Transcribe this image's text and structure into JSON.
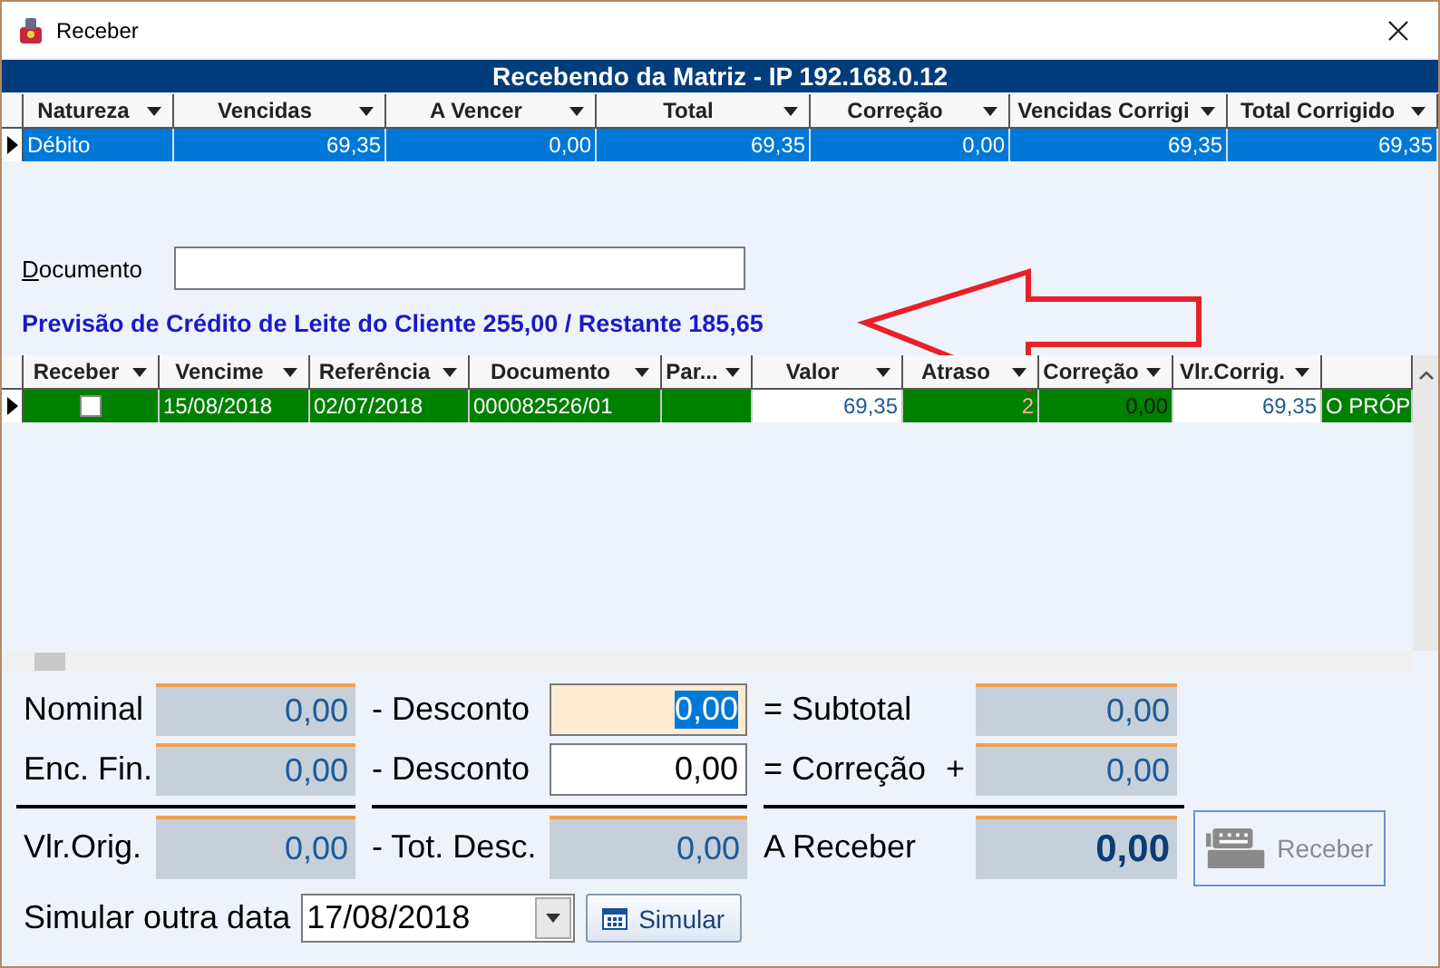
{
  "window": {
    "title": "Receber"
  },
  "header": {
    "title": "Recebendo da Matriz - IP 192.168.0.12"
  },
  "summary_table": {
    "columns": [
      "Natureza",
      "Vencidas",
      "A Vencer",
      "Total",
      "Correção",
      "Vencidas Corrigi",
      "Total Corrigido"
    ],
    "rows": [
      {
        "selected": true,
        "cells": [
          "Débito",
          "69,35",
          "0,00",
          "69,35",
          "0,00",
          "69,35",
          "69,35"
        ]
      }
    ]
  },
  "document_field": {
    "label": "Documento"
  },
  "credit_note": "Previsão de Crédito de Leite do Cliente 255,00 / Restante 185,65",
  "detail_table": {
    "columns": [
      "Receber",
      "Vencime",
      "Referência",
      "Documento",
      "Par...",
      "Valor",
      "Atraso",
      "Correção",
      "Vlr.Corrig."
    ],
    "rows": [
      {
        "selected": true,
        "cells": [
          {
            "kind": "check",
            "checked": false
          },
          {
            "kind": "text",
            "text": "15/08/2018"
          },
          {
            "kind": "text",
            "text": "02/07/2018"
          },
          {
            "kind": "text",
            "text": "000082526/01"
          },
          {
            "kind": "blank"
          },
          {
            "kind": "amount",
            "text": "69,35"
          },
          {
            "kind": "delay",
            "text": "2"
          },
          {
            "kind": "correction",
            "text": "0,00"
          },
          {
            "kind": "amount",
            "text": "69,35"
          },
          {
            "kind": "text",
            "text": "O PRÓP"
          }
        ]
      }
    ]
  },
  "totals": {
    "rows": [
      [
        {
          "label": "Nominal",
          "value": "0,00",
          "kind": "display"
        },
        {
          "label": "- Desconto",
          "value": "0,00",
          "kind": "input",
          "focused": true
        },
        {
          "label": "= Subtotal",
          "value": "0,00",
          "kind": "display"
        }
      ],
      [
        {
          "label": "Enc. Fin.",
          "value": "0,00",
          "kind": "display"
        },
        {
          "label": "- Desconto",
          "value": "0,00",
          "kind": "input",
          "focused": false
        },
        {
          "label": "= Correção",
          "operator": "+",
          "value": "0,00",
          "kind": "display"
        }
      ],
      [
        {
          "label": "Vlr.Orig.",
          "value": "0,00",
          "kind": "display"
        },
        {
          "label": "- Tot. Desc.",
          "value": "0,00",
          "kind": "display"
        },
        {
          "label": "A Receber",
          "value": "0,00",
          "kind": "total"
        }
      ]
    ]
  },
  "receive_button": {
    "label": "Receber",
    "disabled": true
  },
  "simulate": {
    "label": "Simular outra data",
    "date": "17/08/2018",
    "button": "Simular"
  }
}
